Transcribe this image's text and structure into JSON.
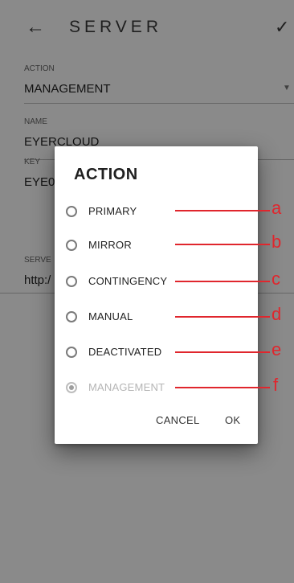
{
  "toolbar": {
    "title": "SERVER",
    "back_icon": "←",
    "check_icon": "✓"
  },
  "form": {
    "action_label": "ACTION",
    "action_value": "MANAGEMENT",
    "name_label": "NAME",
    "name_value": "EYERCLOUD",
    "key_label": "KEY",
    "key_value": "EYE0",
    "server_label": "SERVE",
    "server_value": "http:/",
    "dropdown_icon": "▼"
  },
  "dialog": {
    "title": "ACTION",
    "options": [
      {
        "label": "PRIMARY",
        "selected": false,
        "enabled": true,
        "marker": "a"
      },
      {
        "label": "MIRROR",
        "selected": false,
        "enabled": true,
        "marker": "b"
      },
      {
        "label": "CONTINGENCY",
        "selected": false,
        "enabled": true,
        "marker": "c"
      },
      {
        "label": "MANUAL",
        "selected": false,
        "enabled": true,
        "marker": "d"
      },
      {
        "label": "DEACTIVATED",
        "selected": false,
        "enabled": true,
        "marker": "e"
      },
      {
        "label": "MANAGEMENT",
        "selected": true,
        "enabled": false,
        "marker": "f"
      }
    ],
    "cancel_label": "CANCEL",
    "ok_label": "OK"
  },
  "colors": {
    "annotation": "#e0262d",
    "scrim": "rgba(0,0,0,0.46)"
  }
}
